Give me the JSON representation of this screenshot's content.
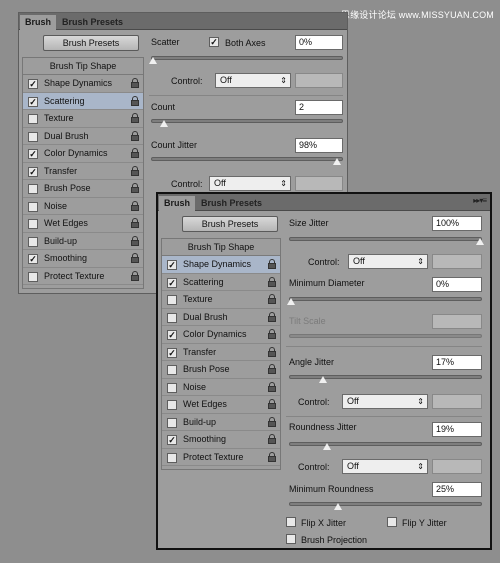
{
  "watermark": "思缘设计论坛 www.MISSYUAN.COM",
  "tabs": {
    "brush": "Brush",
    "presets": "Brush Presets"
  },
  "menu_icon": "▸▸▾≡",
  "brush_presets_button": "Brush Presets",
  "brush_tip_shape": "Brush Tip Shape",
  "left_items": [
    {
      "label": "Shape Dynamics",
      "checked": true
    },
    {
      "label": "Scattering",
      "checked": true
    },
    {
      "label": "Texture",
      "checked": false
    },
    {
      "label": "Dual Brush",
      "checked": false
    },
    {
      "label": "Color Dynamics",
      "checked": true
    },
    {
      "label": "Transfer",
      "checked": true
    },
    {
      "label": "Brush Pose",
      "checked": false
    },
    {
      "label": "Noise",
      "checked": false
    },
    {
      "label": "Wet Edges",
      "checked": false
    },
    {
      "label": "Build-up",
      "checked": false
    },
    {
      "label": "Smoothing",
      "checked": true
    },
    {
      "label": "Protect Texture",
      "checked": false
    }
  ],
  "back_panel": {
    "selected_index": 1,
    "scatter_label": "Scatter",
    "both_axes_label": "Both Axes",
    "both_axes_checked": true,
    "scatter_value": "0%",
    "scatter_level": 0.0,
    "control_label": "Control:",
    "control_value": "Off",
    "count_label": "Count",
    "count_value": "2",
    "count_level": 0.06,
    "count_jitter_label": "Count Jitter",
    "count_jitter_value": "98%",
    "count_jitter_level": 0.98,
    "control2_label": "Control:",
    "control2_value": "Off"
  },
  "front_panel": {
    "selected_index": 0,
    "size_jitter_label": "Size Jitter",
    "size_jitter_value": "100%",
    "size_jitter_level": 1.0,
    "control_label": "Control:",
    "control_value": "Off",
    "min_diameter_label": "Minimum Diameter",
    "min_diameter_value": "0%",
    "min_diameter_level": 0.0,
    "tilt_scale_label": "Tilt Scale",
    "angle_jitter_label": "Angle Jitter",
    "angle_jitter_value": "17%",
    "angle_jitter_level": 0.17,
    "control2_label": "Control:",
    "control2_value": "Off",
    "roundness_jitter_label": "Roundness Jitter",
    "roundness_jitter_value": "19%",
    "roundness_jitter_level": 0.19,
    "control3_label": "Control:",
    "control3_value": "Off",
    "min_roundness_label": "Minimum Roundness",
    "min_roundness_value": "25%",
    "min_roundness_level": 0.25,
    "flip_x_label": "Flip X Jitter",
    "flip_y_label": "Flip Y Jitter",
    "brush_projection_label": "Brush Projection"
  }
}
